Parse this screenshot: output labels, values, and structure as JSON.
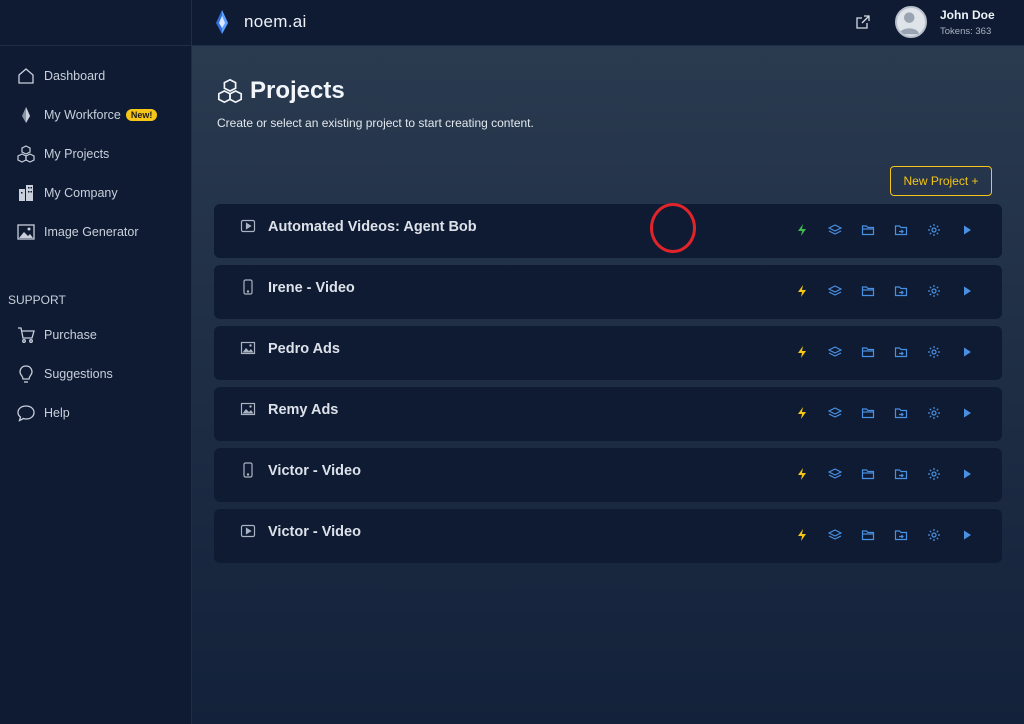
{
  "app": {
    "name": "noem.ai"
  },
  "user": {
    "name": "John Doe",
    "tokens_label": "Tokens: 363"
  },
  "sidebar": {
    "items": [
      {
        "label": "Dashboard",
        "icon": "home-icon"
      },
      {
        "label": "My Workforce",
        "icon": "agent-icon",
        "badge": "New!"
      },
      {
        "label": "My Projects",
        "icon": "cubes-icon"
      },
      {
        "label": "My Company",
        "icon": "building-icon"
      },
      {
        "label": "Image Generator",
        "icon": "image-icon"
      }
    ],
    "support_title": "SUPPORT",
    "support_items": [
      {
        "label": "Purchase",
        "icon": "cart-icon"
      },
      {
        "label": "Suggestions",
        "icon": "lightbulb-icon"
      },
      {
        "label": "Help",
        "icon": "chat-bubble-icon"
      }
    ]
  },
  "page": {
    "title": "Projects",
    "subtitle": "Create or select an existing project to start creating content.",
    "new_project_label": "New Project +"
  },
  "projects": [
    {
      "name": "Automated Videos: Agent Bob",
      "type": "video",
      "bolt_color": "#3fb950"
    },
    {
      "name": "Irene - Video",
      "type": "mobile",
      "bolt_color": "#f5c518"
    },
    {
      "name": "Pedro Ads",
      "type": "image",
      "bolt_color": "#f5c518"
    },
    {
      "name": "Remy Ads",
      "type": "image",
      "bolt_color": "#f5c518"
    },
    {
      "name": "Victor - Video",
      "type": "mobile",
      "bolt_color": "#f5c518"
    },
    {
      "name": "Victor - Video",
      "type": "video",
      "bolt_color": "#f5c518"
    }
  ],
  "colors": {
    "accent": "#f5c518",
    "action_blue": "#4a90e2",
    "highlight": "#e0242a"
  }
}
